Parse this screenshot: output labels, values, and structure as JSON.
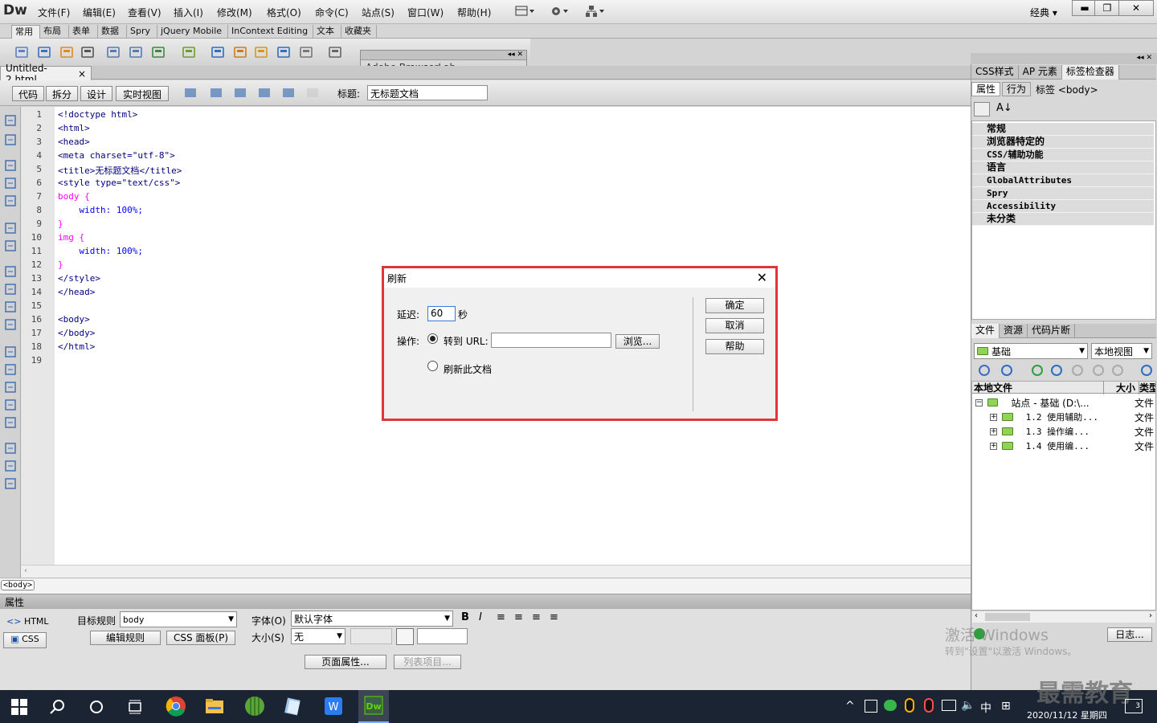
{
  "app": {
    "logo": "Dw",
    "workspace_label": "经典"
  },
  "menu": [
    "文件(F)",
    "编辑(E)",
    "查看(V)",
    "插入(I)",
    "修改(M)",
    "格式(O)",
    "命令(C)",
    "站点(S)",
    "窗口(W)",
    "帮助(H)"
  ],
  "insert_tabs": [
    "常用",
    "布局",
    "表单",
    "数据",
    "Spry",
    "jQuery Mobile",
    "InContext Editing",
    "文本",
    "收藏夹"
  ],
  "float_panel": {
    "title": "Adobe BrowserLab"
  },
  "document": {
    "tab_name": "Untitled-2.html",
    "close_glyph": "×",
    "views": [
      "代码",
      "拆分",
      "设计",
      "实时视图"
    ],
    "title_label": "标题:",
    "title_value": "无标题文档"
  },
  "code_lines": [
    {
      "n": "1",
      "text": "<!doctype html>"
    },
    {
      "n": "2",
      "text": "<html>"
    },
    {
      "n": "3",
      "text": "<head>"
    },
    {
      "n": "4",
      "text": "<meta charset=\"utf-8\">"
    },
    {
      "n": "5",
      "text": "<title>无标题文档</title>"
    },
    {
      "n": "6",
      "text": "<style type=\"text/css\">"
    },
    {
      "n": "7",
      "text": "body {"
    },
    {
      "n": "8",
      "text": "    width: 100%;"
    },
    {
      "n": "9",
      "text": "}"
    },
    {
      "n": "10",
      "text": "img {"
    },
    {
      "n": "11",
      "text": "    width: 100%;"
    },
    {
      "n": "12",
      "text": "}"
    },
    {
      "n": "13",
      "text": "</style>"
    },
    {
      "n": "14",
      "text": "</head>"
    },
    {
      "n": "15",
      "text": ""
    },
    {
      "n": "16",
      "text": "<body>"
    },
    {
      "n": "17",
      "text": "</body>"
    },
    {
      "n": "18",
      "text": "</html>"
    },
    {
      "n": "19",
      "text": ""
    }
  ],
  "status_tag": "<body>",
  "properties": {
    "header": "属性",
    "html_label": "HTML",
    "css_label": "CSS",
    "target_rule_label": "目标规则",
    "target_rule_value": "body",
    "edit_rule": "编辑规则",
    "css_panel": "CSS 面板(P)",
    "font_label": "字体(O)",
    "font_value": "默认字体",
    "size_label": "大小(S)",
    "size_value": "无",
    "page_props": "页面属性...",
    "list_item": "列表项目..."
  },
  "right_panel": {
    "tabs": [
      "CSS样式",
      "AP 元素",
      "标签检查器"
    ],
    "subtabs": [
      "属性",
      "行为"
    ],
    "tag_label": "标签 <body>",
    "categories": [
      "常规",
      "浏览器特定的",
      "CSS/辅助功能",
      "语言",
      "GlobalAttributes",
      "Spry",
      "Accessibility",
      "未分类"
    ],
    "files_tabs": [
      "文件",
      "资源",
      "代码片断"
    ],
    "site_select": "基础",
    "view_select": "本地视图",
    "col_local": "本地文件",
    "col_size": "大小",
    "col_type": "类型",
    "root": "站点 - 基础 (D:\\...",
    "root_type": "文件",
    "items": [
      {
        "name": "1.2 使用辅助...",
        "type": "文件"
      },
      {
        "name": "1.3 操作编...",
        "type": "文件"
      },
      {
        "name": "1.4 使用编...",
        "type": "文件"
      }
    ],
    "log_button": "日志..."
  },
  "dialog": {
    "title": "刷新",
    "delay_label": "延迟:",
    "delay_value": "60",
    "seconds": "秒",
    "action_label": "操作:",
    "goto_url": "转到 URL:",
    "browse": "浏览...",
    "refresh_doc": "刷新此文档",
    "ok": "确定",
    "cancel": "取消",
    "help": "帮助"
  },
  "watermark": {
    "line1": "激活 Windows",
    "line2": "转到\"设置\"以激活 Windows。",
    "brand": "最需教育"
  },
  "taskbar": {
    "ime": "中",
    "date": "2020/11/12 星期四",
    "notif_count": "3"
  }
}
